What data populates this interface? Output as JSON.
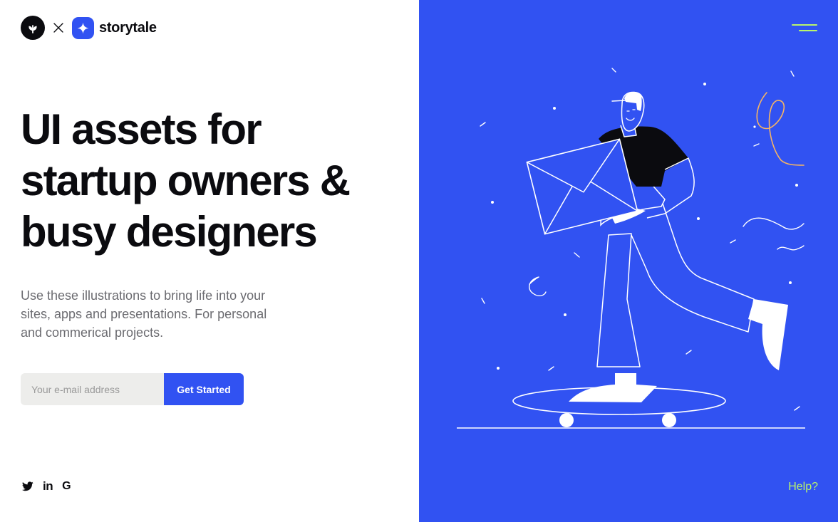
{
  "brand": {
    "name": "storytale",
    "partner_icon": "sprout-icon",
    "separator_icon": "times-icon",
    "logo_icon": "sparkle-icon"
  },
  "hero": {
    "headline_lines": [
      "UI assets for",
      "startup owners &",
      "busy designers"
    ],
    "sub_lines": [
      "Use these illustrations to bring life into your",
      "sites, apps and presentations. For personal",
      "and commerical projects."
    ]
  },
  "signup": {
    "email_placeholder": "Your e-mail address",
    "email_value": "",
    "cta_label": "Get Started"
  },
  "social": {
    "twitter_icon": "twitter-icon",
    "linkedin_label": "in",
    "google_label": "G"
  },
  "right_panel": {
    "menu_icon": "hamburger-icon",
    "help_label": "Help?"
  },
  "colors": {
    "accent_blue": "#3152f2",
    "lime": "#b9f56b",
    "ink": "#0b0b0f",
    "muted_text": "#6b6b70",
    "input_bg": "#ededeb",
    "doodle_orange": "#f5b464"
  }
}
